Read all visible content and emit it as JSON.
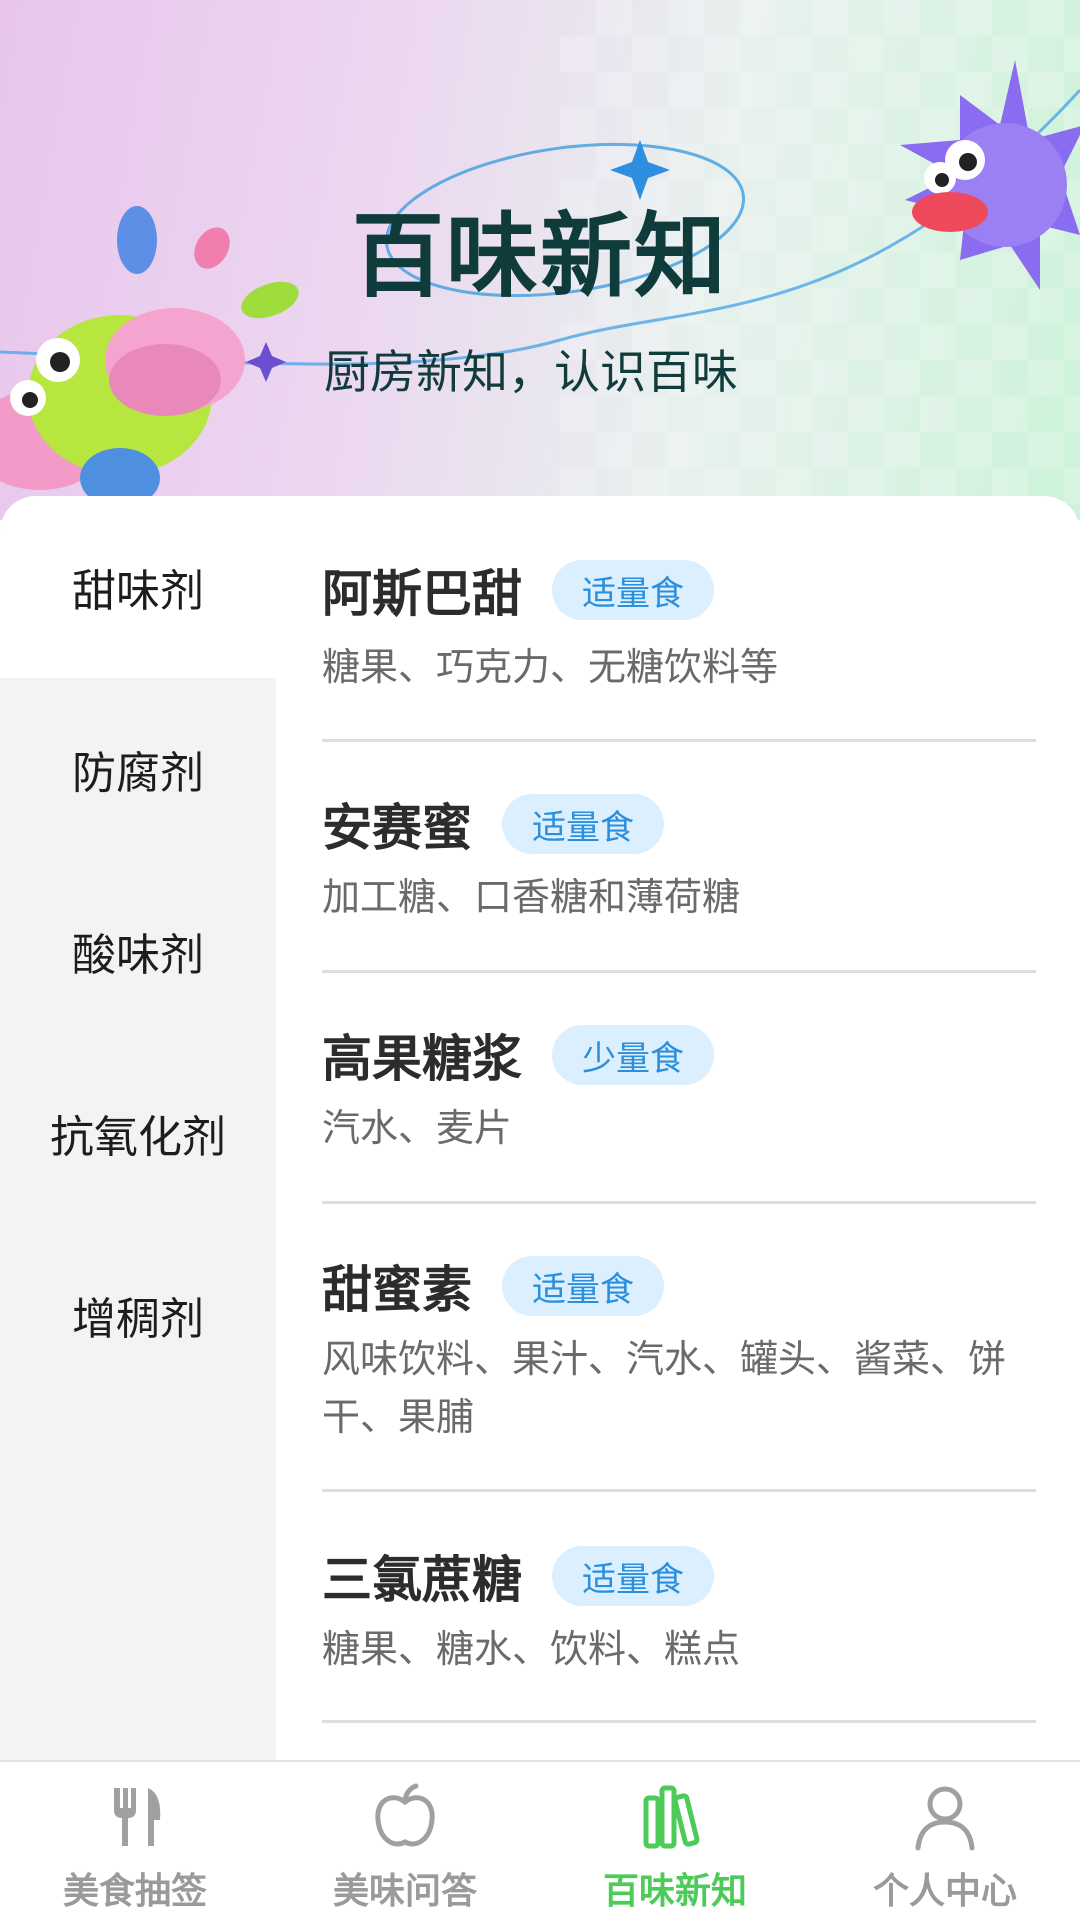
{
  "header": {
    "title": "百味新知",
    "subtitle": "厨房新知，认识百味"
  },
  "sidebar": {
    "items": [
      {
        "label": "甜味剂",
        "active": true
      },
      {
        "label": "防腐剂",
        "active": false
      },
      {
        "label": "酸味剂",
        "active": false
      },
      {
        "label": "抗氧化剂",
        "active": false
      },
      {
        "label": "增稠剂",
        "active": false
      }
    ]
  },
  "list": {
    "items": [
      {
        "name": "阿斯巴甜",
        "badge": "适量食",
        "desc": "糖果、巧克力、无糖饮料等"
      },
      {
        "name": "安赛蜜",
        "badge": "适量食",
        "desc": "加工糖、口香糖和薄荷糖"
      },
      {
        "name": "高果糖浆",
        "badge": "少量食",
        "desc": "汽水、麦片"
      },
      {
        "name": "甜蜜素",
        "badge": "适量食",
        "desc": "风味饮料、果汁、汽水、罐头、酱菜、饼干、果脯"
      },
      {
        "name": "三氯蔗糖",
        "badge": "适量食",
        "desc": "糖果、糖水、饮料、糕点"
      }
    ]
  },
  "tabbar": {
    "tabs": [
      {
        "label": "美食抽签",
        "icon": "fork-knife-icon",
        "active": false
      },
      {
        "label": "美味问答",
        "icon": "apple-icon",
        "active": false
      },
      {
        "label": "百味新知",
        "icon": "books-icon",
        "active": true
      },
      {
        "label": "个人中心",
        "icon": "person-icon",
        "active": false
      }
    ]
  },
  "colors": {
    "accent": "#4ccb58",
    "badge_bg": "#dcefff",
    "badge_text": "#2b8fdc",
    "title": "#0f3b3a"
  }
}
